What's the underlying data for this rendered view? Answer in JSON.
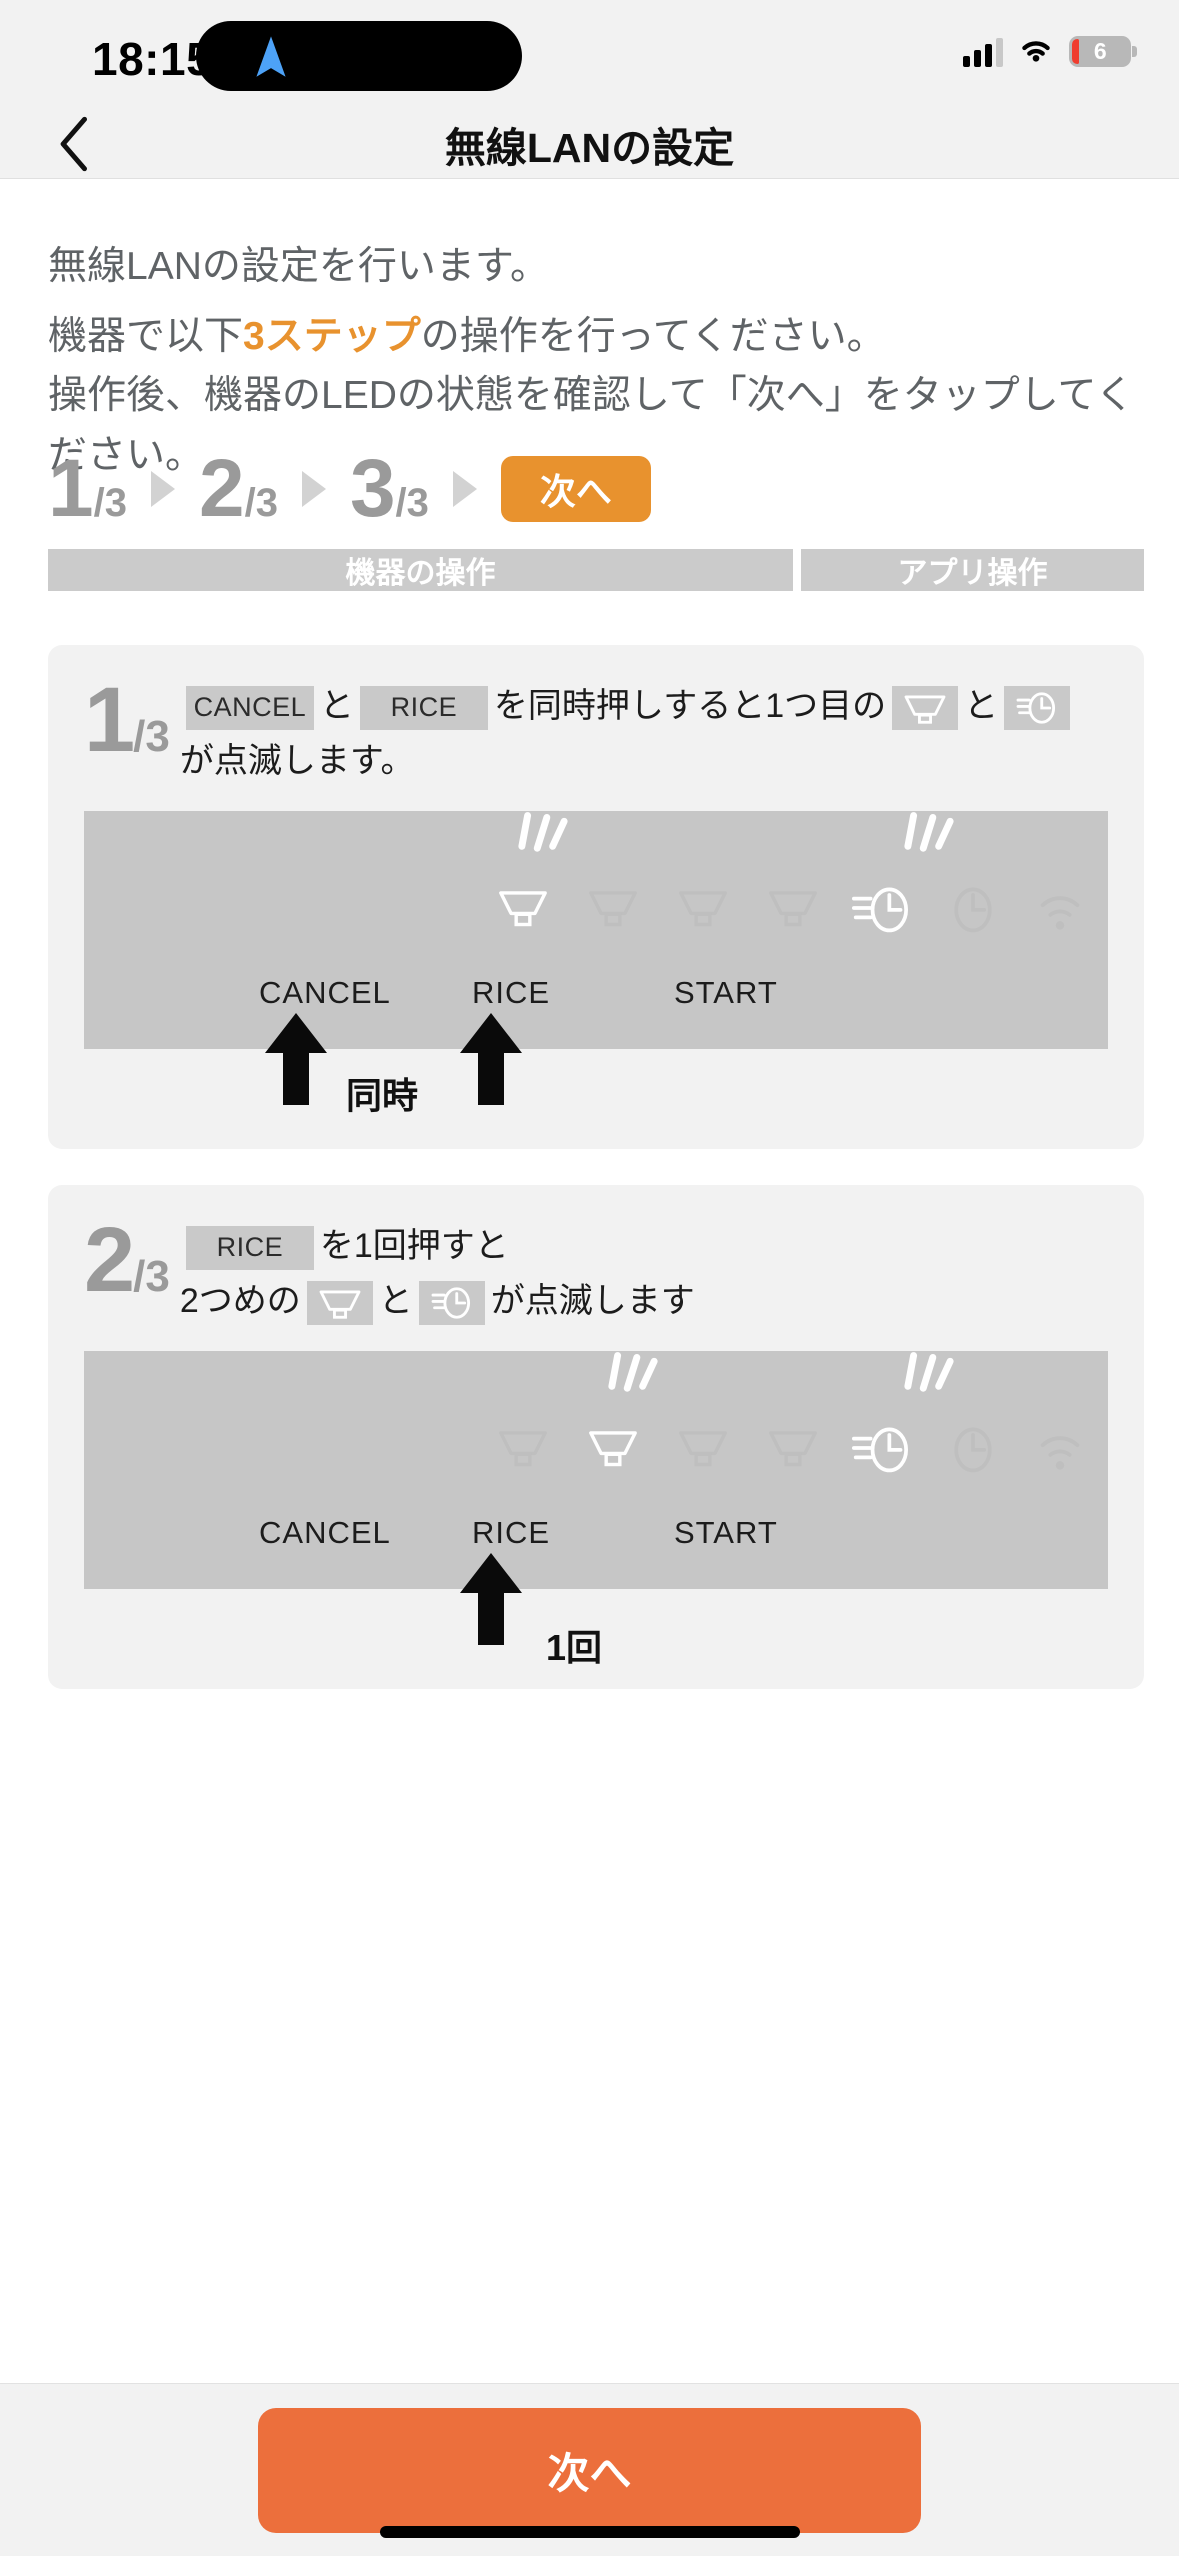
{
  "status_bar": {
    "time": "18:15",
    "location_icon": "location-arrow-icon",
    "navigation_icon": "navigation-arrow-icon",
    "signal_icon": "cellular-signal-icon",
    "wifi_icon": "wifi-icon",
    "battery_percent": "6"
  },
  "nav": {
    "back_icon": "chevron-left-icon",
    "title": "無線LANの設定"
  },
  "intro": {
    "line1": "無線LANの設定を行います。",
    "line2_prefix": "機器で以下",
    "line2_highlight": "3ステップ",
    "line2_suffix": "の操作を行ってください。",
    "line3": "操作後、機器のLEDの状態を確認して「次へ」をタップしてください。"
  },
  "progress": {
    "steps": [
      {
        "num": "1",
        "denom": "/3"
      },
      {
        "num": "2",
        "denom": "/3"
      },
      {
        "num": "3",
        "denom": "/3"
      }
    ],
    "next_label": "次へ",
    "bar_device": "機器の操作",
    "bar_app": "アプリ操作"
  },
  "steps": [
    {
      "num": "1",
      "denom": "/3",
      "text_a": "を同時押しすると1つ",
      "text_b": "目の",
      "text_c": "と",
      "text_d": "が点滅します。",
      "chip1": "CANCEL",
      "conj1": "と",
      "chip2": "RICE",
      "panel": {
        "buttons": [
          "CANCEL",
          "RICE",
          "START"
        ],
        "bowls_total": 4,
        "bowl_active_index": 1,
        "timer_active": true,
        "clock_active": false,
        "wifi_active": false,
        "arrow_targets": [
          "CANCEL",
          "RICE"
        ],
        "arrow_label": "同時"
      }
    },
    {
      "num": "2",
      "denom": "/3",
      "chip1": "RICE",
      "text_a": "を1回押すと",
      "text_b": "2つめの",
      "text_c": "と",
      "text_d": "が点滅します",
      "panel": {
        "buttons": [
          "CANCEL",
          "RICE",
          "START"
        ],
        "bowls_total": 4,
        "bowl_active_index": 2,
        "timer_active": true,
        "clock_active": false,
        "wifi_active": false,
        "arrow_targets": [
          "RICE"
        ],
        "arrow_label": "1回"
      }
    }
  ],
  "cta": {
    "label": "次へ"
  },
  "colors": {
    "accent_button": "#EC6F3C",
    "accent_step": "#E8922E",
    "panel_gray": "#C6C6C6",
    "chip_gray": "#C9C9C9",
    "text_gray": "#5F6366"
  }
}
